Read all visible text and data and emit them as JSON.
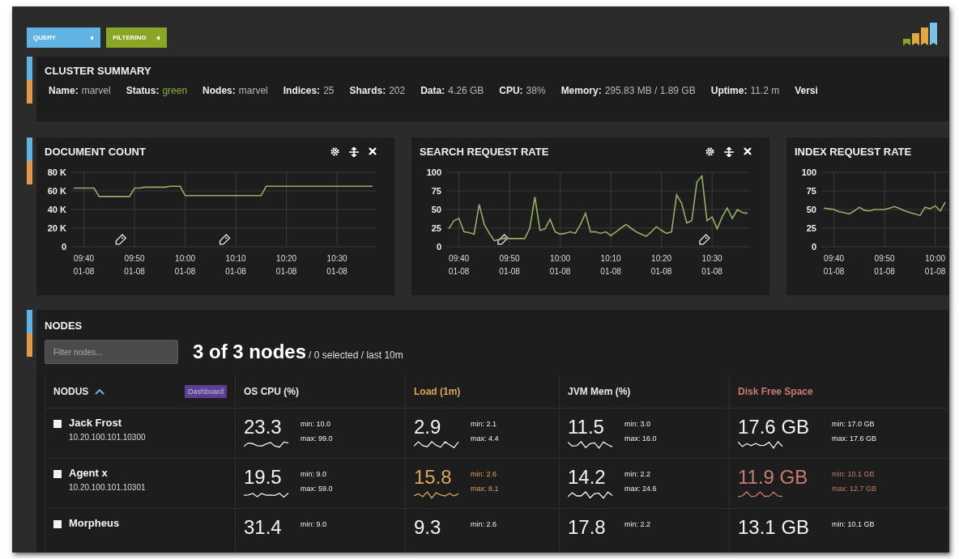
{
  "toolbar": {
    "buttons": [
      {
        "label": "QUERY",
        "kind": "query"
      },
      {
        "label": "FILTERING",
        "kind": "filtering"
      }
    ]
  },
  "cluster_summary": {
    "title": "CLUSTER SUMMARY",
    "items": [
      {
        "label": "Name:",
        "value": "marvel"
      },
      {
        "label": "Status:",
        "value": "green",
        "color": "#8fb03a"
      },
      {
        "label": "Nodes:",
        "value": "marvel"
      },
      {
        "label": "Indices:",
        "value": "25"
      },
      {
        "label": "Shards:",
        "value": "202"
      },
      {
        "label": "Data:",
        "value": "4.26 GB"
      },
      {
        "label": "CPU:",
        "value": "38%"
      },
      {
        "label": "Memory:",
        "value": "295.83 MB / 1.89 GB"
      },
      {
        "label": "Uptime:",
        "value": "11.2 m"
      },
      {
        "label": "Versi"
      }
    ]
  },
  "charts": [
    {
      "title": "DOCUMENT COUNT",
      "show_controls": true,
      "chart_data": {
        "type": "line",
        "grid": true,
        "ylim": [
          0,
          80
        ],
        "categories": [
          null,
          null,
          "09:40 01-08",
          null,
          null,
          null,
          null,
          null,
          null,
          null,
          null,
          null,
          "09:50 01-08",
          null,
          null,
          null,
          null,
          null,
          null,
          null,
          null,
          null,
          "10:00 01-08",
          null,
          null,
          null,
          null,
          null,
          null,
          null,
          null,
          null,
          "10:10 01-08",
          null,
          null,
          null,
          null,
          null,
          null,
          null,
          null,
          null,
          "10:20 01-08",
          null,
          null,
          null,
          null,
          null,
          null,
          null,
          null,
          null,
          "10:30 01-08",
          null,
          null,
          null,
          null,
          null,
          null,
          null
        ],
        "yticks": [
          {
            "value": 0,
            "label": "0"
          },
          {
            "value": 20,
            "label": "20 K"
          },
          {
            "value": 40,
            "label": "40 K"
          },
          {
            "value": 60,
            "label": "60 K"
          },
          {
            "value": 80,
            "label": "80 K"
          }
        ],
        "series": [
          {
            "color": "#93b065",
            "values": [
              63,
              63,
              63,
              63,
              63,
              54,
              54,
              54,
              54,
              54,
              54,
              54,
              63,
              63,
              64,
              64,
              64,
              64,
              64,
              65,
              65,
              65,
              55,
              55,
              55,
              55,
              55,
              55,
              55,
              55,
              55,
              55,
              55,
              55,
              55,
              55,
              55,
              55,
              65,
              65,
              65,
              65,
              65,
              65,
              65,
              65,
              65,
              65,
              65,
              65,
              65,
              65,
              65,
              65,
              65,
              65,
              65,
              65,
              65,
              65
            ]
          }
        ]
      }
    },
    {
      "title": "SEARCH REQUEST RATE",
      "show_controls": true,
      "chart_data": {
        "type": "line",
        "grid": true,
        "ylim": [
          0,
          100
        ],
        "categories": [
          null,
          null,
          "09:40 01-08",
          null,
          null,
          null,
          null,
          null,
          null,
          null,
          null,
          null,
          "09:50 01-08",
          null,
          null,
          null,
          null,
          null,
          null,
          null,
          null,
          null,
          "10:00 01-08",
          null,
          null,
          null,
          null,
          null,
          null,
          null,
          null,
          null,
          "10:10 01-08",
          null,
          null,
          null,
          null,
          null,
          null,
          null,
          null,
          null,
          "10:20 01-08",
          null,
          null,
          null,
          null,
          null,
          null,
          null,
          null,
          null,
          "10:30 01-08",
          null,
          null,
          null,
          null,
          null,
          null,
          null
        ],
        "yticks": [
          0,
          25,
          50,
          75,
          100
        ],
        "series": [
          {
            "color": "#93b065",
            "values": [
              24,
              35,
              38,
              20,
              19,
              17,
              57,
              30,
              18,
              8,
              10,
              11,
              11,
              11,
              11,
              11,
              25,
              67,
              22,
              24,
              37,
              20,
              17,
              18,
              20,
              18,
              30,
              45,
              20,
              20,
              18,
              20,
              15,
              20,
              25,
              30,
              25,
              20,
              17,
              14,
              20,
              27,
              22,
              18,
              20,
              70,
              58,
              32,
              35,
              87,
              95,
              35,
              40,
              24,
              40,
              52,
              38,
              50,
              46,
              45
            ]
          }
        ]
      }
    },
    {
      "title": "INDEX REQUEST RATE",
      "chart_data": {
        "type": "line",
        "grid": true,
        "ylim": [
          0,
          100
        ],
        "categories": [
          null,
          null,
          "09:40 01-08",
          null,
          null,
          null,
          null,
          null,
          null,
          null,
          null,
          null,
          "09:50 01-08",
          null,
          null,
          null,
          null,
          null,
          null,
          null,
          null,
          null,
          "10:00 01-08",
          null,
          null
        ],
        "yticks": [
          0,
          25,
          50,
          75,
          100
        ],
        "series": [
          {
            "color": "#93b065",
            "values": [
              52,
              51,
              50,
              47,
              46,
              44,
              48,
              53,
              49,
              48,
              50,
              50,
              50,
              52,
              54,
              51,
              48,
              46,
              44,
              42,
              53,
              51,
              55,
              48,
              60
            ]
          }
        ]
      }
    }
  ],
  "nodes": {
    "title": "NODES",
    "filter": {
      "placeholder": "Filter nodes..."
    },
    "count": "3 of 3 nodes",
    "count_detail": "/ 0 selected / last 10m",
    "columns": [
      {
        "label": "NODUS",
        "sorted": true,
        "badge": "Dashboard",
        "color": "#e8e8e8"
      },
      {
        "label": "OS CPU (%)",
        "sorted": false,
        "color": "#e8e8e8"
      },
      {
        "label": "Load (1m)",
        "sorted": false,
        "color": "#d9a659"
      },
      {
        "label": "JVM Mem (%)",
        "sorted": false,
        "color": "#e8e8e8"
      },
      {
        "label": "Disk Free Space",
        "sorted": false,
        "color": "#c97b70"
      }
    ],
    "rows": [
      {
        "cells": [
          {
            "kind": "node",
            "name": "Jack Frost",
            "address": "10.20.100.101.10300",
            "checked": false
          },
          {
            "kind": "metric",
            "value": "23.3",
            "min": "min: 10.0",
            "max": "max: 99.0",
            "color": "#f2f2f2"
          },
          {
            "kind": "metric",
            "value": "2.9",
            "min": "min: 2.1",
            "max": "max: 4.4",
            "color": "#f2f2f2"
          },
          {
            "kind": "metric",
            "value": "11.5",
            "min": "min: 3.0",
            "max": "max: 16.0",
            "color": "#f2f2f2"
          },
          {
            "kind": "metric",
            "value": "17.6 GB",
            "min": "min: 17.0 GB",
            "max": "max: 17.6 GB",
            "color": "#f2f2f2"
          }
        ]
      },
      {
        "cells": [
          {
            "kind": "node",
            "name": "Agent x",
            "address": "10.20.100.101.10301",
            "checked": false
          },
          {
            "kind": "metric",
            "value": "19.5",
            "min": "min: 9.0",
            "max": "max: 59.0",
            "color": "#f2f2f2"
          },
          {
            "kind": "metric",
            "value": "15.8",
            "min": "min: 2.6",
            "max": "max: 8.1",
            "color": "#d9a659"
          },
          {
            "kind": "metric",
            "value": "14.2",
            "min": "min: 2.2",
            "max": "max: 24.6",
            "color": "#f2f2f2"
          },
          {
            "kind": "metric",
            "value": "11.9 GB",
            "min": "min: 10.1 GB",
            "max": "max: 12.7 GB",
            "color": "#c97b70"
          }
        ]
      },
      {
        "cells": [
          {
            "kind": "node",
            "name": "Morpheus",
            "checked": false
          },
          {
            "kind": "metric",
            "value": "31.4",
            "min": "min: 9.0",
            "color": "#f2f2f2"
          },
          {
            "kind": "metric",
            "value": "9.3",
            "min": "min: 2.6",
            "color": "#f2f2f2"
          },
          {
            "kind": "metric",
            "value": "17.8",
            "min": "min: 2.2",
            "color": "#f2f2f2"
          },
          {
            "kind": "metric",
            "value": "13.1 GB",
            "min": "min: 10.1 GB",
            "color": "#f2f2f2"
          }
        ]
      }
    ]
  }
}
